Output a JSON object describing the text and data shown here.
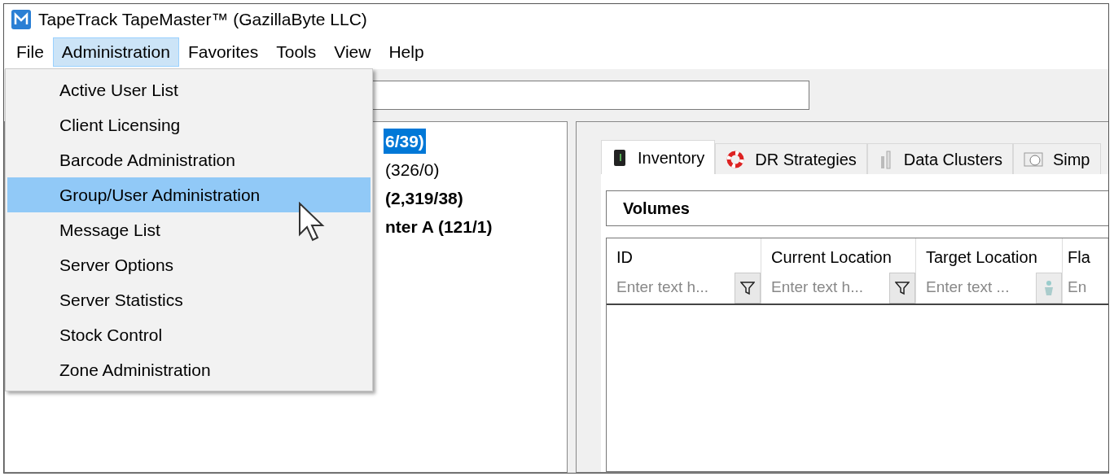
{
  "window": {
    "title": "TapeTrack TapeMaster™ (GazillaByte LLC)"
  },
  "menu_bar": [
    {
      "label": "File",
      "selected": false
    },
    {
      "label": "Administration",
      "selected": true
    },
    {
      "label": "Favorites",
      "selected": false
    },
    {
      "label": "Tools",
      "selected": false
    },
    {
      "label": "View",
      "selected": false
    },
    {
      "label": "Help",
      "selected": false
    }
  ],
  "dropdown": [
    {
      "label": "Active User List",
      "selected": false
    },
    {
      "label": "Client Licensing",
      "selected": false
    },
    {
      "label": "Barcode Administration",
      "selected": false
    },
    {
      "label": "Group/User Administration",
      "selected": true
    },
    {
      "label": "Message List",
      "selected": false
    },
    {
      "label": "Server Options",
      "selected": false
    },
    {
      "label": "Server Statistics",
      "selected": false
    },
    {
      "label": "Stock Control",
      "selected": false
    },
    {
      "label": "Zone Administration",
      "selected": false
    }
  ],
  "tree": [
    {
      "label": "6/39)",
      "selected": true,
      "bold": true
    },
    {
      "label": "(326/0)",
      "selected": false,
      "bold": false
    },
    {
      "label": "(2,319/38)",
      "selected": false,
      "bold": true
    },
    {
      "label": "nter A (121/1)",
      "selected": false,
      "bold": true
    }
  ],
  "tabs": [
    {
      "label": "Inventory",
      "selected": true,
      "kind": "tape"
    },
    {
      "label": "DR Strategies",
      "selected": false,
      "kind": "lifebuoy"
    },
    {
      "label": "Data Clusters",
      "selected": false,
      "kind": "cluster"
    },
    {
      "label": "Simp",
      "selected": false,
      "kind": "clock"
    }
  ],
  "section_title": "Volumes",
  "columns": [
    {
      "header": "ID",
      "placeholder": "Enter text h...",
      "kind": "funnel"
    },
    {
      "header": "Current Location",
      "placeholder": "Enter text h...",
      "kind": "funnel"
    },
    {
      "header": "Target Location",
      "placeholder": "Enter text ...",
      "kind": "figure"
    },
    {
      "header": "Fla",
      "placeholder": "En",
      "kind": "none"
    }
  ]
}
